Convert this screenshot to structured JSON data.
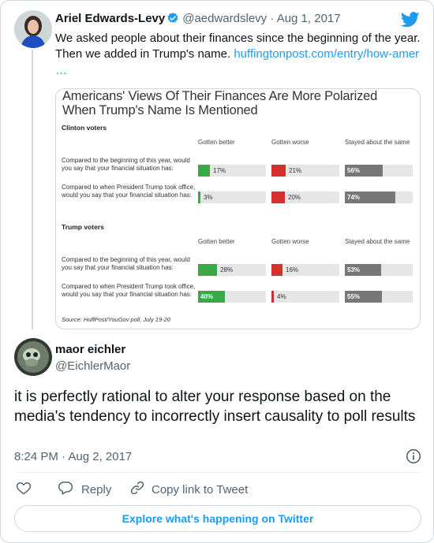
{
  "quoted_tweet": {
    "author_name": "Ariel Edwards-Levy",
    "handle": "@aedwardslevy",
    "separator": "·",
    "date": "Aug 1, 2017",
    "text": "We asked people about their finances since the beginning of the year. Then we added in Trump's name. ",
    "link": "huffingtonpost.com/entry/how-amer",
    "ellipsis": "…",
    "icons": [
      "verified-badge-icon",
      "twitter-bird-icon"
    ],
    "colors": {
      "verified": "#1d9bf0",
      "bird": "#1d9bf0"
    }
  },
  "chart_data": {
    "type": "bar",
    "title": "Americans' Views Of Their Finances Are More Polarized When Trump's Name Is Mentioned",
    "columns": [
      "Gotten better",
      "Gotten worse",
      "Stayed about the same"
    ],
    "colors": {
      "better": "#3aa845",
      "worse": "#d62f2f",
      "same": "#777777",
      "track": "#e6e6e6"
    },
    "groups": [
      {
        "name": "Clinton voters",
        "questions": [
          {
            "text": "Compared to the beginning of this year, would you say that your financial situation has:",
            "values": [
              17,
              21,
              56
            ],
            "labels": [
              "17%",
              "21%",
              "56%"
            ]
          },
          {
            "text": "Compared to when President Trump took office, would you say that your financial situation has:",
            "values": [
              3,
              20,
              74
            ],
            "labels": [
              "3%",
              "20%",
              "74%"
            ]
          }
        ]
      },
      {
        "name": "Trump voters",
        "questions": [
          {
            "text": "Compared to the beginning of this year, would you say that your financial situation has:",
            "values": [
              28,
              16,
              53
            ],
            "labels": [
              "28%",
              "16%",
              "53%"
            ]
          },
          {
            "text": "Compared to when President Trump took office, would you say that your financial situation has:",
            "values": [
              40,
              4,
              55
            ],
            "labels": [
              "40%",
              "4%",
              "55%"
            ]
          }
        ]
      }
    ],
    "source": "Source: HuffPost/YouGov poll, July 19-20"
  },
  "main_tweet": {
    "author_name": "maor eichler",
    "handle": "@EichlerMaor",
    "text": "it is perfectly rational to alter your response based on the media's tendency to incorrectly insert causality to poll results",
    "timestamp": "8:24 PM · Aug 2, 2017"
  },
  "actions": {
    "like_label": "",
    "reply_label": "Reply",
    "copy_label": "Copy link to Tweet",
    "icons": [
      "heart-icon",
      "reply-icon",
      "link-icon",
      "info-icon"
    ]
  },
  "footer": {
    "explore_label": "Explore what's happening on Twitter"
  }
}
